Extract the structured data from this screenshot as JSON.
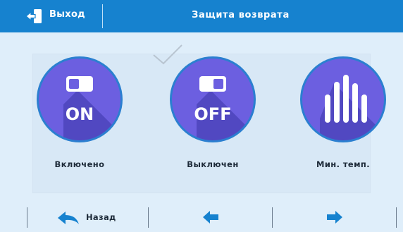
{
  "header": {
    "exit_label": "Выход",
    "title": "Защита возврата"
  },
  "options": [
    {
      "label": "Включено",
      "badge": "ON",
      "icon": "toggle-on-icon"
    },
    {
      "label": "Выключен",
      "badge": "OFF",
      "icon": "toggle-off-icon"
    },
    {
      "label": "Мин. темп.",
      "icon": "bar-chart-icon"
    }
  ],
  "footer": {
    "back_label": "Назад",
    "prev_icon": "arrow-left-icon",
    "next_icon": "arrow-right-icon"
  },
  "colors": {
    "header_bg": "#1682cf",
    "circle_fill": "#6c5fe0",
    "circle_border": "#2b7fd0",
    "shadow": "#3d34a8",
    "accent_icon": "#1682cf",
    "background": "#dfeefa"
  }
}
